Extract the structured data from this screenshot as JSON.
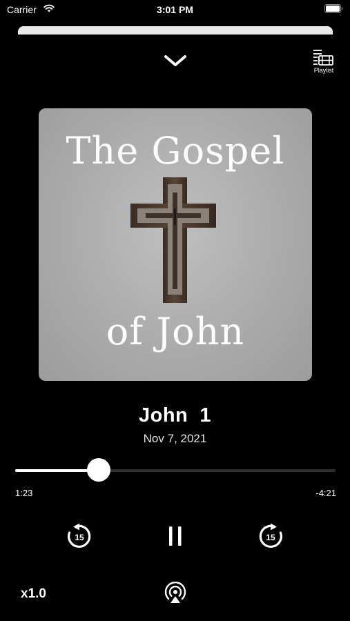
{
  "status_bar": {
    "carrier": "Carrier",
    "time": "3:01 PM"
  },
  "header": {
    "collapse_icon": "chevron-down-icon",
    "playlist_label": "Playlist",
    "playlist_icon": "playlist-icon"
  },
  "artwork": {
    "line1": "The Gospel",
    "line2": "of John"
  },
  "track": {
    "title": "John  1",
    "date": "Nov 7, 2021"
  },
  "playback": {
    "elapsed": "1:23",
    "remaining": "-4:21",
    "progress_fraction": 0.26,
    "skip_back_label": "15",
    "skip_forward_label": "15",
    "state": "playing"
  },
  "footer": {
    "speed": "x1.0",
    "airplay_icon": "airplay-audio-icon"
  },
  "colors": {
    "background": "#000000",
    "text": "#ffffff",
    "track_bg": "#2c2c2c",
    "artwork_bg": "#a9a9a9"
  }
}
